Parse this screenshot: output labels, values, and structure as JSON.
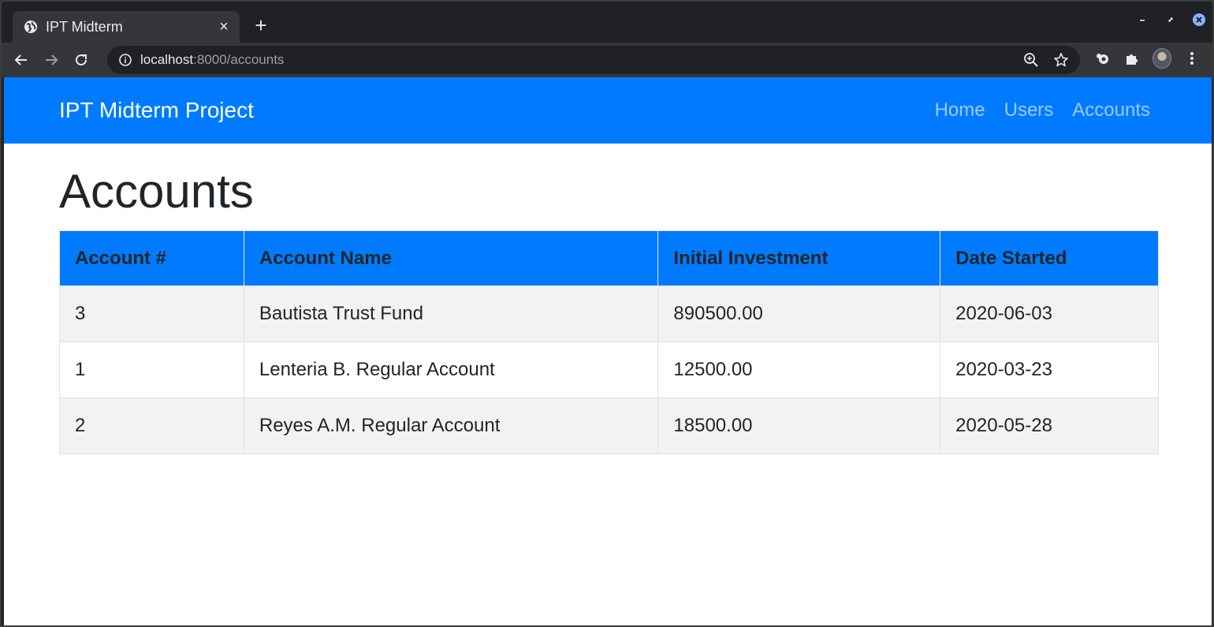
{
  "browser": {
    "tab_title": "IPT Midterm",
    "url_host": "localhost",
    "url_rest": ":8000/accounts",
    "icons": {
      "favicon": "globe-icon",
      "close": "close-icon",
      "new_tab": "plus-icon",
      "back": "arrow-left-icon",
      "forward": "arrow-right-icon",
      "reload": "reload-icon",
      "info": "info-icon",
      "zoom": "zoom-icon",
      "bookmark": "star-icon",
      "extensions": "puzzle-icon",
      "menu": "kebab-menu-icon"
    }
  },
  "navbar": {
    "brand": "IPT Midterm Project",
    "links": [
      "Home",
      "Users",
      "Accounts"
    ],
    "color": "#007bff"
  },
  "main": {
    "title": "Accounts",
    "table": {
      "headers": [
        "Account #",
        "Account Name",
        "Initial Investment",
        "Date Started"
      ],
      "rows": [
        [
          "3",
          "Bautista Trust Fund",
          "890500.00",
          "2020-06-03"
        ],
        [
          "1",
          "Lenteria B. Regular Account",
          "12500.00",
          "2020-03-23"
        ],
        [
          "2",
          "Reyes A.M. Regular Account",
          "18500.00",
          "2020-05-28"
        ]
      ]
    }
  }
}
